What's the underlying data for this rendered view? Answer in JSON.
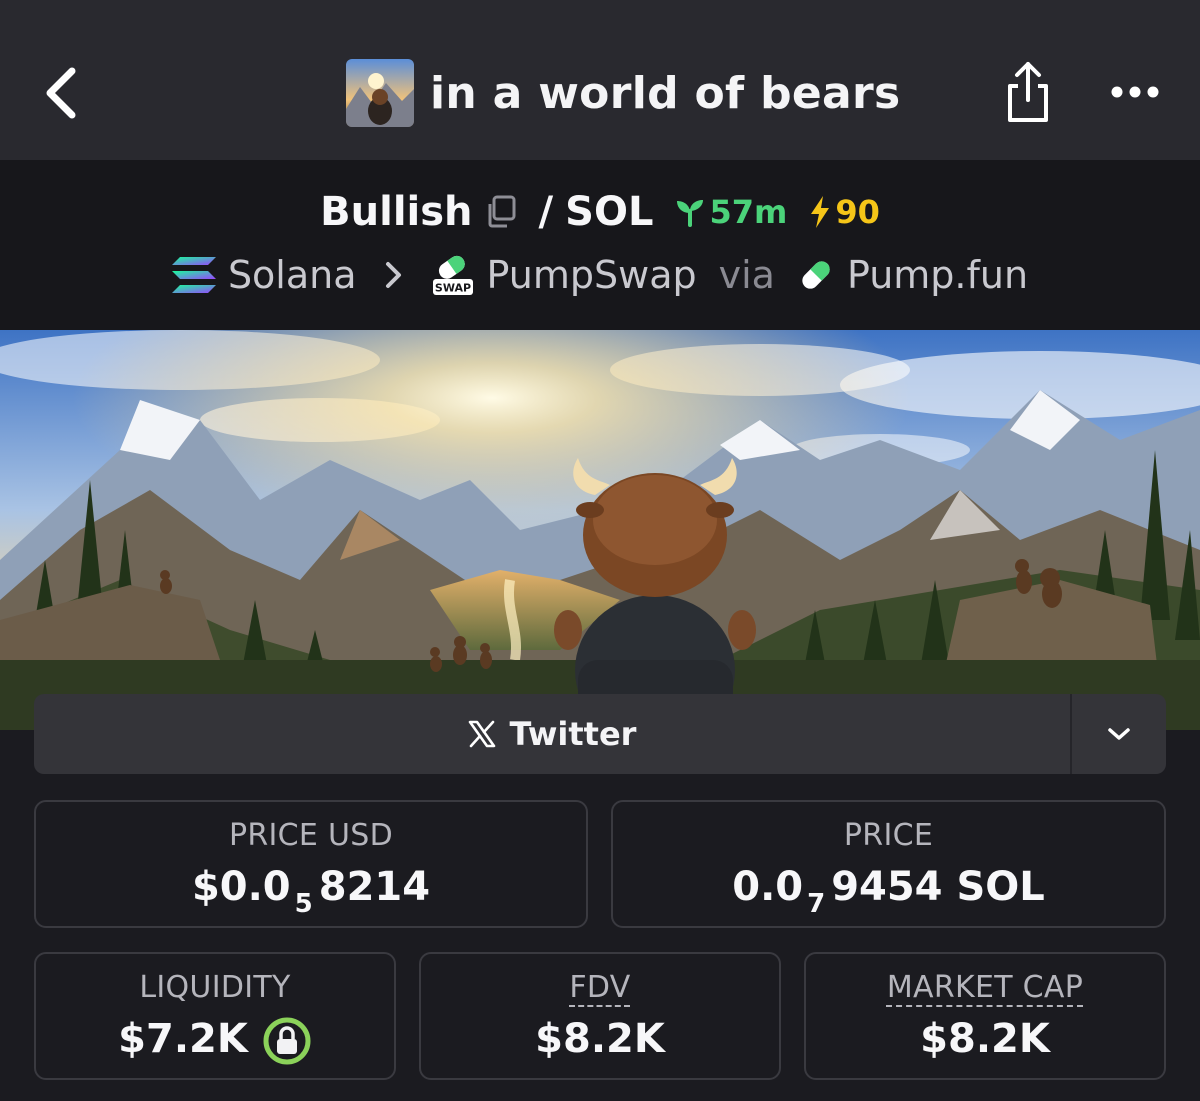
{
  "header": {
    "title": "in a world of bears"
  },
  "pair": {
    "base": "Bullish",
    "separator": "/",
    "quote": "SOL",
    "age": "57m",
    "boosts": "90",
    "chain": "Solana",
    "dex": "PumpSwap",
    "dex_badge": "SWAP",
    "via": "via",
    "launchpad": "Pump.fun"
  },
  "socials": {
    "twitter_label": "Twitter"
  },
  "stats": {
    "price_usd": {
      "label": "PRICE USD",
      "prefix": "$0.0",
      "zeros": "5",
      "digits": "8214"
    },
    "price_native": {
      "label": "PRICE",
      "prefix": "0.0",
      "zeros": "7",
      "digits": "9454 SOL"
    },
    "liquidity": {
      "label": "LIQUIDITY",
      "value": "$7.2K"
    },
    "fdv": {
      "label": "FDV",
      "value": "$8.2K"
    },
    "market_cap": {
      "label": "MARKET CAP",
      "value": "$8.2K"
    }
  },
  "colors": {
    "accent_green": "#4bd37a",
    "boost_yellow": "#f5c518",
    "lock_green": "#8bd25a"
  },
  "icons": [
    "back-icon",
    "share-icon",
    "more-icon",
    "copy-icon",
    "sprout-icon",
    "bolt-icon",
    "solana-icon",
    "pumpswap-icon",
    "pill-icon",
    "x-logo-icon",
    "chevron-down-icon",
    "lock-icon"
  ]
}
